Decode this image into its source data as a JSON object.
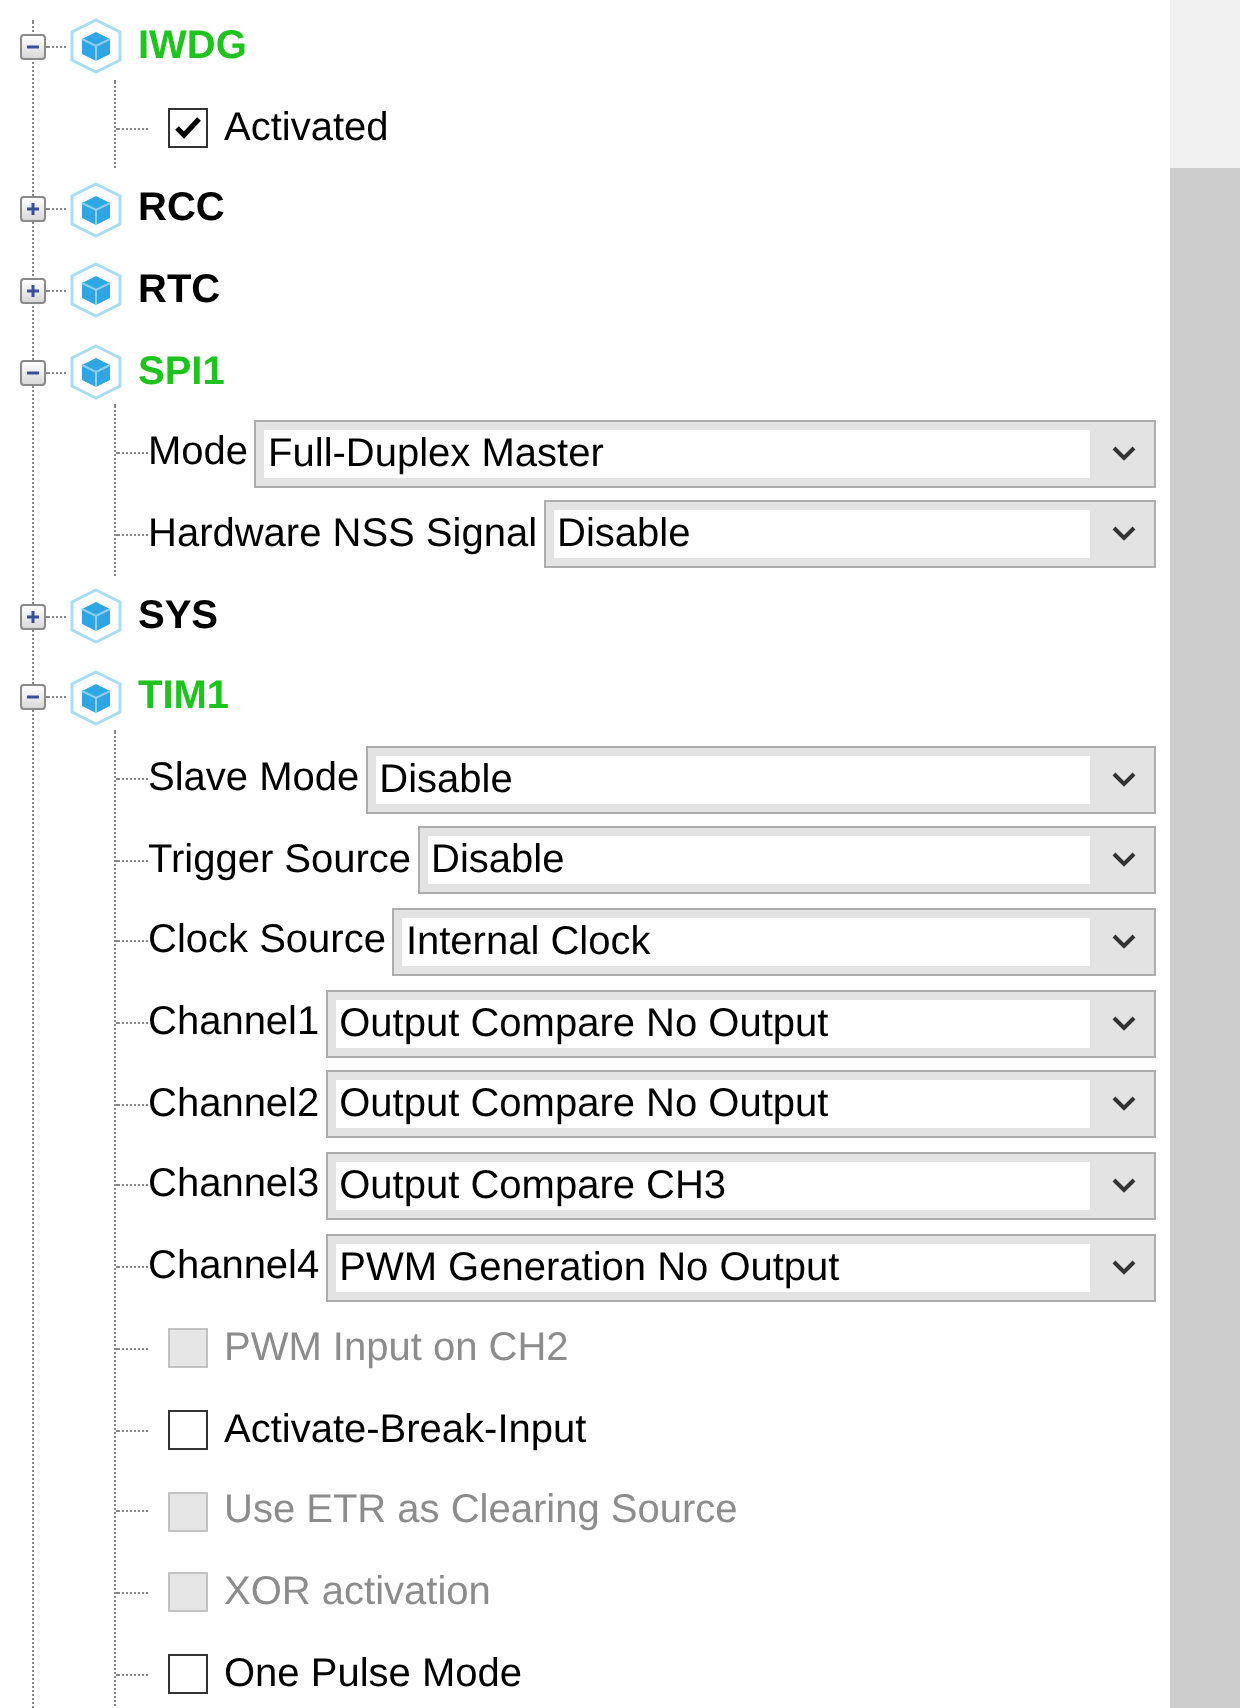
{
  "tree": [
    {
      "label": "IWDG",
      "expanded": true,
      "configured": true,
      "children": [
        {
          "kind": "checkbox",
          "label": "Activated",
          "checked": true,
          "disabled": false
        }
      ]
    },
    {
      "label": "RCC",
      "expanded": false,
      "configured": false
    },
    {
      "label": "RTC",
      "expanded": false,
      "configured": false
    },
    {
      "label": "SPI1",
      "expanded": true,
      "configured": true,
      "children": [
        {
          "kind": "dropdown",
          "label": "Mode",
          "value": "Full-Duplex Master"
        },
        {
          "kind": "dropdown",
          "label": "Hardware NSS Signal",
          "value": "Disable"
        }
      ]
    },
    {
      "label": "SYS",
      "expanded": false,
      "configured": false
    },
    {
      "label": "TIM1",
      "expanded": true,
      "configured": true,
      "children": [
        {
          "kind": "dropdown",
          "label": "Slave Mode",
          "value": "Disable"
        },
        {
          "kind": "dropdown",
          "label": "Trigger Source",
          "value": "Disable"
        },
        {
          "kind": "dropdown",
          "label": "Clock Source",
          "value": "Internal Clock"
        },
        {
          "kind": "dropdown",
          "label": "Channel1",
          "value": "Output Compare No Output"
        },
        {
          "kind": "dropdown",
          "label": "Channel2",
          "value": "Output Compare No Output"
        },
        {
          "kind": "dropdown",
          "label": "Channel3",
          "value": "Output Compare CH3"
        },
        {
          "kind": "dropdown",
          "label": "Channel4",
          "value": "PWM Generation No Output"
        },
        {
          "kind": "checkbox",
          "label": "PWM Input on CH2",
          "checked": false,
          "disabled": true
        },
        {
          "kind": "checkbox",
          "label": "Activate-Break-Input",
          "checked": false,
          "disabled": false
        },
        {
          "kind": "checkbox",
          "label": "Use ETR as Clearing Source",
          "checked": false,
          "disabled": true
        },
        {
          "kind": "checkbox",
          "label": "XOR activation",
          "checked": false,
          "disabled": true
        },
        {
          "kind": "checkbox",
          "label": "One Pulse Mode",
          "checked": false,
          "disabled": false
        }
      ]
    }
  ]
}
